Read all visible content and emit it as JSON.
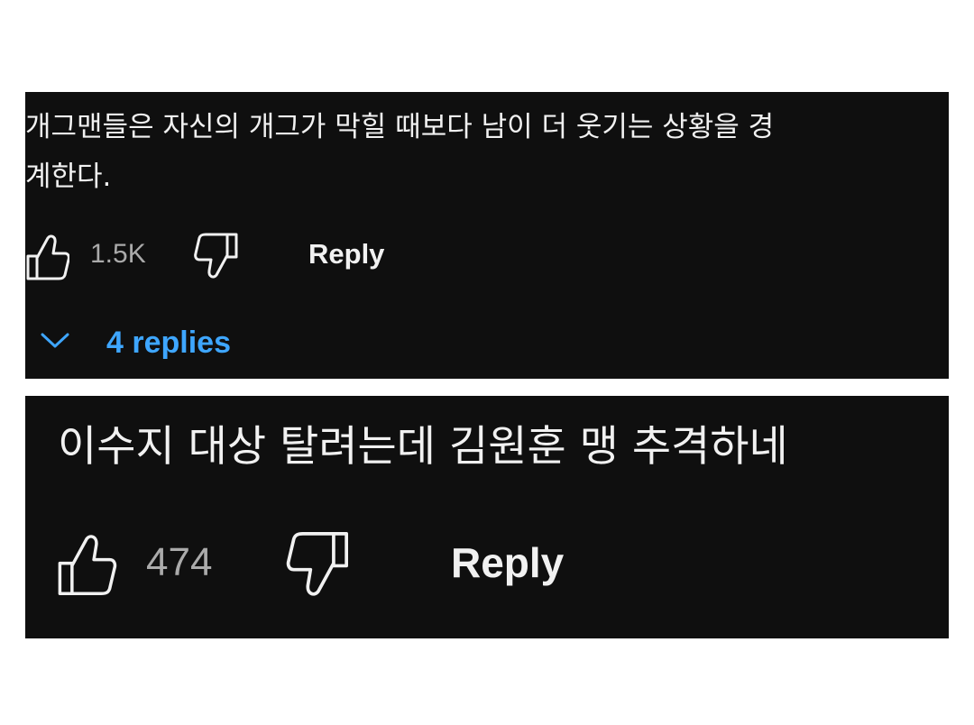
{
  "comments": [
    {
      "text_lines": [
        "개그맨들은 자신의 개그가 막힐 때보다 남이 더 웃기는 상황을  경",
        "계한다."
      ],
      "likes": "1.5K",
      "reply_label": "Reply",
      "replies_label": "4 replies"
    },
    {
      "text_lines": [
        "이수지 대상 탈려는데 김원훈 맹 추격하네"
      ],
      "likes": "474",
      "reply_label": "Reply"
    }
  ],
  "icons": {
    "like": "thumbs-up-icon",
    "dislike": "thumbs-down-icon",
    "expand": "chevron-down-icon"
  },
  "colors": {
    "background": "#0f0f0f",
    "text": "#f1f1f1",
    "count": "#aaaaaa",
    "replies_link": "#3ea6ff"
  }
}
